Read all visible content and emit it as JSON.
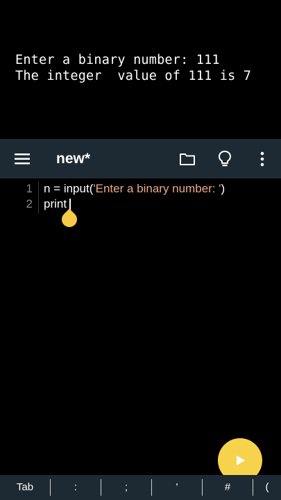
{
  "console": {
    "line1": "Enter a binary number: 111",
    "line2": "The integer  value of 111 is 7"
  },
  "toolbar": {
    "title": "new*",
    "background": "#1e2a33",
    "icons": [
      "menu-icon",
      "folder-icon",
      "lightbulb-icon",
      "more-vert-icon"
    ]
  },
  "editor": {
    "line_numbers": [
      "1",
      "2"
    ],
    "lines": [
      {
        "code_before": "n = input(",
        "string": "'Enter a binary number: '",
        "code_after": ")"
      },
      {
        "code_before": "print",
        "string": "",
        "code_after": ""
      }
    ],
    "string_color": "#e8a98a"
  },
  "run_button": {
    "icon": "play-icon",
    "color": "#f7d34d"
  },
  "keyboard_bar": {
    "keys": [
      "Tab",
      ":",
      ";",
      "'",
      "#",
      "("
    ]
  }
}
